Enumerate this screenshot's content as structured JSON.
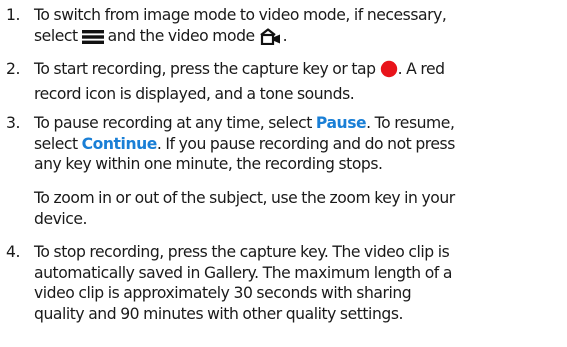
{
  "steps": [
    {
      "number": "1.",
      "line1": "To switch from image mode to video mode, if necessary,",
      "pre_menu": "select ",
      "mid": " and the video mode ",
      "end": "."
    },
    {
      "number": "2.",
      "line1": "To start recording, press the capture key or tap ",
      "line1_end": ". A red",
      "line2": "record icon is displayed, and a tone sounds."
    },
    {
      "number": "3.",
      "line1_pre": "To pause recording at any time, select ",
      "pause": "Pause",
      "line1_post": ". To resume,",
      "line2_pre": "select ",
      "continue": "Continue",
      "line2_post": ". If you pause recording and do not press",
      "line3": "any key within one minute, the recording stops."
    },
    {
      "number": "4.",
      "line1": "To stop recording, press the capture key. The video clip is",
      "line2": "automatically saved in Gallery. The maximum length of a",
      "line3": "video clip is approximately 30 seconds with sharing",
      "line4": "quality and 90 minutes with other quality settings."
    }
  ],
  "note": {
    "line1": "To zoom in or out of the subject, use the zoom key in your",
    "line2": "device."
  },
  "icons": {
    "menu": "menu-icon",
    "video_mode": "video-camera-icon",
    "record": "record-icon",
    "record_color": "#e8141b",
    "highlight_color": "#1a7fd6"
  }
}
